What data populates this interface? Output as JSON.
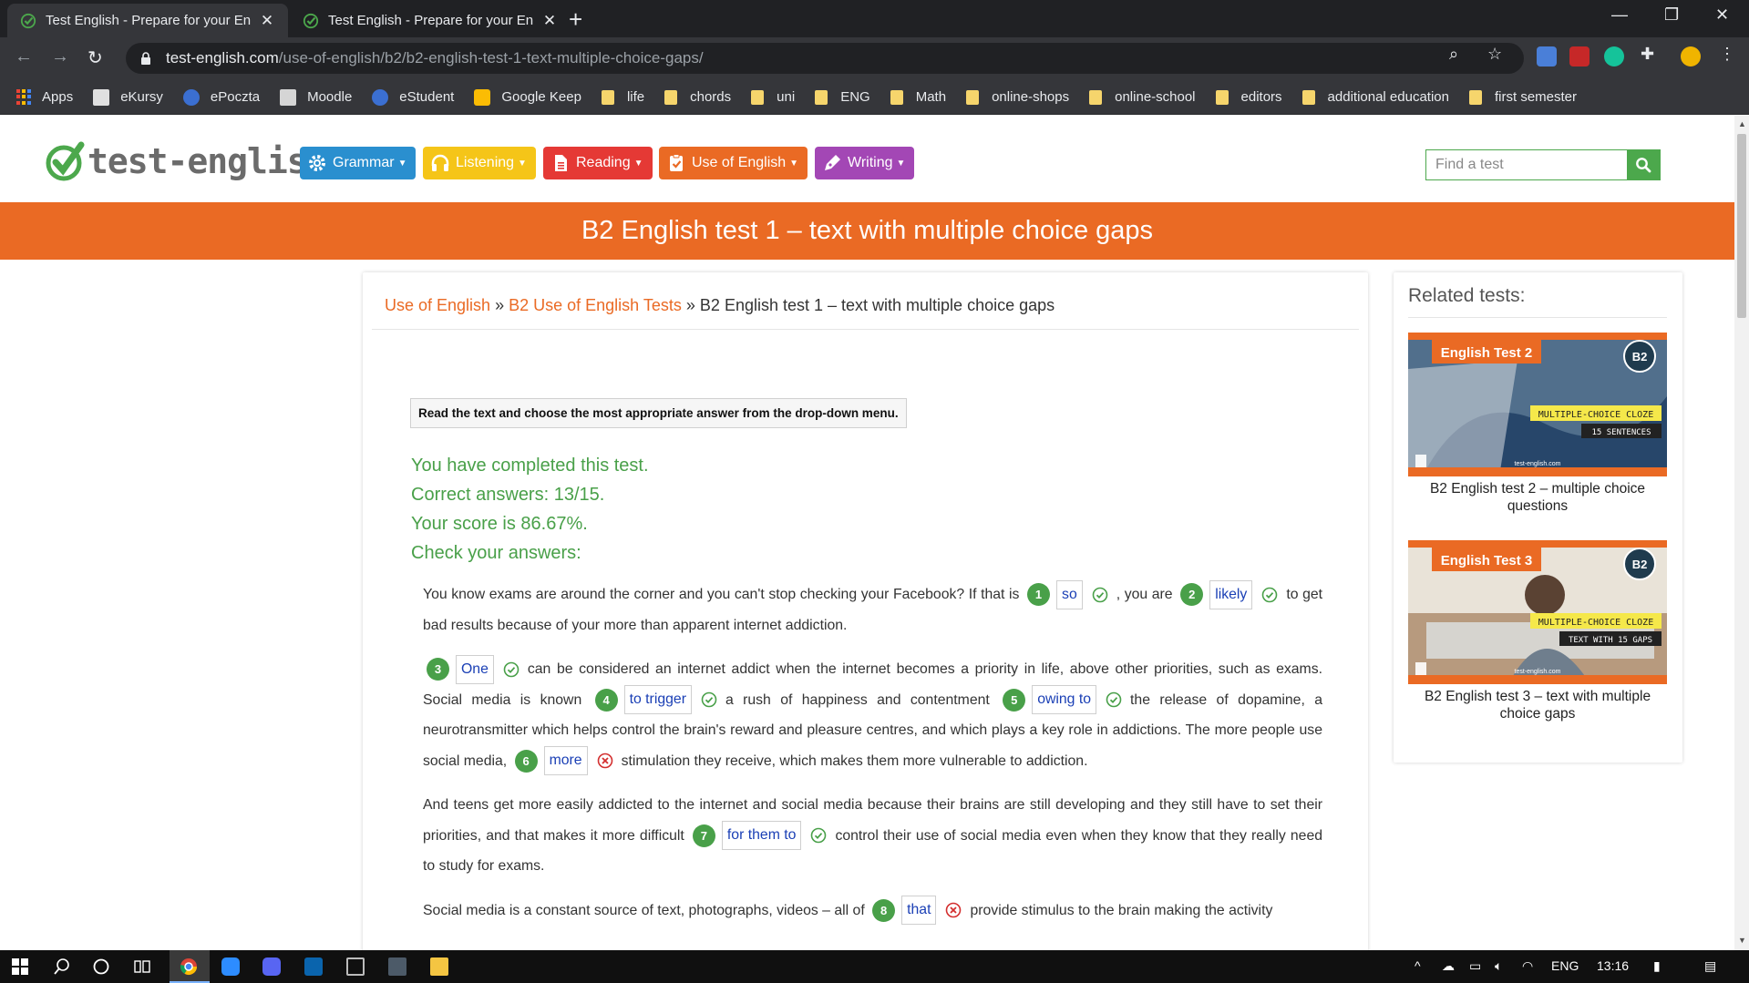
{
  "browser": {
    "tabs": [
      {
        "title": "Test English - Prepare for your En",
        "active": true
      },
      {
        "title": "Test English - Prepare for your En",
        "active": false
      }
    ],
    "url_host": "test-english.com",
    "url_path": "/use-of-english/b2/b2-english-test-1-text-multiple-choice-gaps/",
    "bookmarks": [
      "Apps",
      "eKursy",
      "ePoczta",
      "Moodle",
      "eStudent",
      "Google Keep",
      "life",
      "chords",
      "uni",
      "ENG",
      "Math",
      "online-shops",
      "online-school",
      "editors",
      "additional education",
      "first semester"
    ]
  },
  "site": {
    "logo": "test-english",
    "menu": [
      "Grammar",
      "Listening",
      "Reading",
      "Use of English",
      "Writing"
    ],
    "menu_colors": [
      "#2a8fcf",
      "#f5c518",
      "#e53935",
      "#ea6a24",
      "#a347b5"
    ],
    "search_placeholder": "Find a test",
    "banner_title": "B2 English test 1 – text with multiple choice gaps"
  },
  "breadcrumb": {
    "link1": "Use of English",
    "sep": "»",
    "link2": "B2 Use of English Tests",
    "current": "B2 English test 1 – text with multiple choice gaps"
  },
  "instructions": "Read the text and choose the most appropriate answer from the drop-down menu.",
  "results": {
    "completed": "You have completed this test.",
    "correct": "Correct answers: 13/15.",
    "score": "Your score is 86.67%.",
    "check": "Check your answers:"
  },
  "passage": {
    "p1": {
      "t0": "You know exams are around the corner and you can't stop checking your Facebook? If that is",
      "g1": "1",
      "a1": "so",
      "t1": ", you are",
      "g2": "2",
      "a2": "likely",
      "t2": "to get bad results because of your more than apparent internet addiction."
    },
    "p2": {
      "g3": "3",
      "a3": "One",
      "t3": "can be considered an internet addict when the internet becomes a priority in life, above other priorities, such as exams. Social media is known",
      "g4": "4",
      "a4": "to trigger",
      "t4": "a rush of happiness and contentment",
      "g5": "5",
      "a5": "owing to",
      "t5": "the release of dopamine, a neurotransmitter which helps control the brain's reward and pleasure centres, and which plays a key role in addictions. The more people use social media,",
      "g6": "6",
      "a6": "more",
      "t6": "stimulation they receive, which makes them more vulnerable to addiction."
    },
    "p3": {
      "t0": "And teens get more easily addicted to the internet and social media because their brains are still developing and they still have to set their priorities, and that makes it more difficult",
      "g7": "7",
      "a7": "for them to",
      "t7": "control their use of social media even when they know that they really need to study for exams."
    },
    "p4": {
      "t0": "Social media is a constant source of text, photographs, videos – all of",
      "g8": "8",
      "a8": "that",
      "t8": "provide stimulus to the brain making the activity"
    }
  },
  "sidebar": {
    "title": "Related tests:",
    "cards": [
      {
        "img_title": "English Test 2",
        "badge": "B2",
        "tag1": "MULTIPLE-CHOICE CLOZE",
        "tag2": "15 SENTENCES",
        "site": "test-english.com",
        "caption": "B2 English test 2 – multiple choice questions"
      },
      {
        "img_title": "English Test 3",
        "badge": "B2",
        "tag1": "MULTIPLE-CHOICE CLOZE",
        "tag2": "TEXT WITH 15 GAPS",
        "site": "test-english.com",
        "caption": "B2 English test 3 – text with multiple choice gaps"
      }
    ]
  },
  "taskbar": {
    "lang": "ENG",
    "time": "13:16"
  }
}
